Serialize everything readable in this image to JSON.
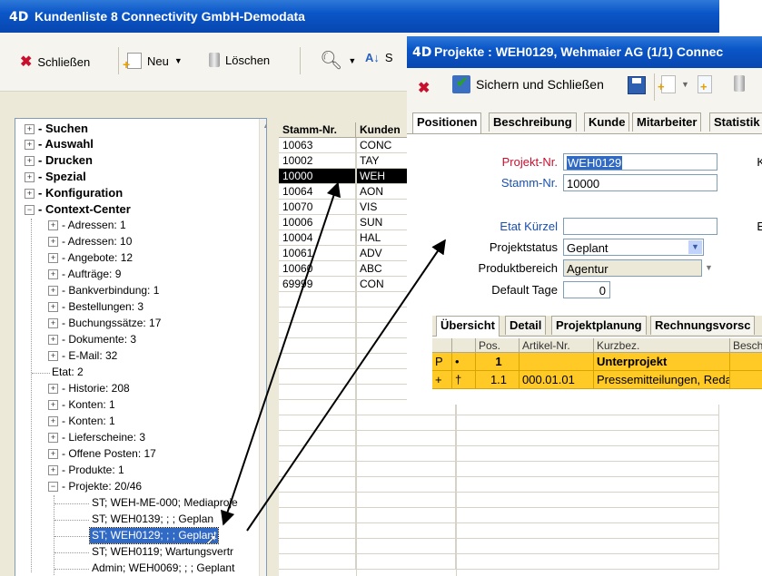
{
  "win1": {
    "title": "Kundenliste 8   Connectivity GmbH-Demodata",
    "logo": "4D",
    "toolbar": {
      "close": "Schließen",
      "new": "Neu",
      "delete": "Löschen",
      "s": "S"
    },
    "tree": {
      "top": [
        "Suchen",
        "Auswahl",
        "Drucken",
        "Spezial",
        "Konfiguration",
        "Context-Center"
      ],
      "children": [
        "- Adressen: 1",
        "- Adressen: 10",
        "- Angebote: 12",
        "- Aufträge: 9",
        "- Bankverbindung: 1",
        "- Bestellungen: 3",
        "- Buchungssätze: 17",
        "- Dokumente: 3",
        "- E-Mail: 32",
        "Etat: 2",
        "- Historie: 208",
        "- Konten: 1",
        "- Konten: 1",
        "- Lieferscheine: 3",
        "- Offene Posten: 17",
        "- Produkte: 1",
        "- Projekte: 20/46"
      ],
      "projects": [
        "ST; WEH-ME-000; Mediaproje",
        "ST; WEH0139; ; ; Geplan",
        "ST; WEH0129; ; ; Geplant",
        "ST; WEH0119; Wartungsvertr",
        "Admin; WEH0069; ; ; Geplant"
      ]
    },
    "grid": {
      "headers": [
        "Stamm-Nr.",
        "Kunden"
      ],
      "rows": [
        [
          "10063",
          "CONC"
        ],
        [
          "10002",
          "TAY"
        ],
        [
          "10000",
          "WEH"
        ],
        [
          "10064",
          "AON"
        ],
        [
          "10070",
          "VIS"
        ],
        [
          "10006",
          "SUN"
        ],
        [
          "10004",
          "HAL"
        ],
        [
          "10061",
          "ADV"
        ],
        [
          "10060",
          "ABC"
        ],
        [
          "69999",
          "CON"
        ]
      ]
    }
  },
  "win2": {
    "title": "Projekte : WEH0129, Wehmaier AG (1/1) Connec",
    "logo": "4D",
    "toolbar": {
      "save_close": "Sichern und Schließen"
    },
    "tabs": [
      "Positionen",
      "Beschreibung",
      "Kunde",
      "Mitarbeiter",
      "Statistik"
    ],
    "fields": {
      "projekt_nr_label": "Projekt-Nr.",
      "projekt_nr": "WEH0129",
      "stamm_nr_label": "Stamm-Nr.",
      "stamm_nr": "10000",
      "etat_label": "Etat Kürzel",
      "etat": "",
      "status_label": "Projektstatus",
      "status": "Geplant",
      "bereich_label": "Produktbereich",
      "bereich": "Agentur",
      "tage_label": "Default Tage",
      "tage": "0",
      "k_label": "K",
      "e_label": "E"
    },
    "subtabs": [
      "Übersicht",
      "Detail",
      "Projektplanung",
      "Rechnungsvorsc"
    ],
    "subgrid": {
      "headers": [
        "",
        "",
        "Pos.",
        "Artikel-Nr.",
        "Kurzbez.",
        "Besch"
      ],
      "rows": [
        [
          "P",
          "•",
          "1",
          "",
          "Unterprojekt",
          ""
        ],
        [
          "+",
          "†",
          "1.1",
          "000.01.01",
          "Pressemitteilungen, Reda",
          ""
        ]
      ]
    }
  }
}
